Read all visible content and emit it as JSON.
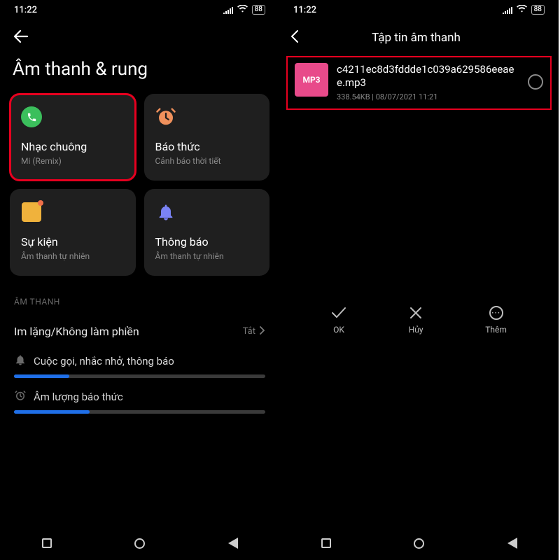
{
  "status": {
    "time": "11:22",
    "battery": "88"
  },
  "screen1": {
    "title": "Âm thanh & rung",
    "tiles": {
      "ringtone": {
        "title": "Nhạc chuông",
        "subtitle": "Mi (Remix)"
      },
      "alarm": {
        "title": "Báo thức",
        "subtitle": "Cảnh báo thời tiết"
      },
      "events": {
        "title": "Sự kiện",
        "subtitle": "Âm thanh tự nhiên"
      },
      "notif": {
        "title": "Thông báo",
        "subtitle": "Âm thanh tự nhiên"
      }
    },
    "section_audio": "ÂM THANH",
    "dnd": {
      "label": "Im lặng/Không làm phiền",
      "value": "Tắt"
    },
    "vol_calls": "Cuộc gọi, nhắc nhở, thông báo",
    "vol_alarm": "Âm lượng báo thức"
  },
  "screen2": {
    "title": "Tập tin âm thanh",
    "file": {
      "badge": "MP3",
      "name": "c4211ec8d3fddde1c039a629586eeaee.mp3",
      "size": "338.54KB",
      "sep": " | ",
      "date": "08/07/2021 11:21"
    },
    "actions": {
      "ok": "OK",
      "cancel": "Hủy",
      "more": "Thêm"
    }
  }
}
